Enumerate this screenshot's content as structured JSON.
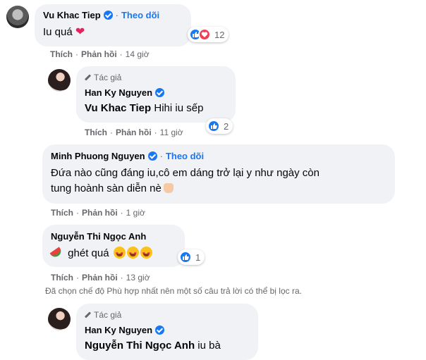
{
  "colors": {
    "accent": "#1877f2",
    "bubble": "#f0f2f5",
    "secondary_text": "#65676b",
    "love": "#f33e58"
  },
  "labels": {
    "like": "Thích",
    "reply": "Phản hồi",
    "follow": "Theo dõi",
    "author_tag": "Tác giả",
    "sep": "·"
  },
  "comments": [
    {
      "author": "Vu Khac Tiep",
      "verified": true,
      "follow": true,
      "text": "Iu quá",
      "emoji": "heart",
      "time": "14 giờ",
      "reaction_count": "12",
      "reactions": [
        "like",
        "love"
      ]
    },
    {
      "author": "Han Ky Nguyen",
      "verified": true,
      "author_tag": true,
      "mention": "Vu Khac Tiep",
      "text": "Hihi iu sếp",
      "time": "11 giờ",
      "reaction_count": "2",
      "reactions": [
        "like"
      ]
    },
    {
      "author": "Minh Phuong Nguyen",
      "verified": true,
      "follow": true,
      "text_line1": "Đứa nào cũng đáng iu,cô em dáng trở lại y như ngày còn",
      "text_line2": "tung hoành sàn diễn nè",
      "emoji": "thumbs-up",
      "time": "1 giờ"
    },
    {
      "author": "Nguyễn Thi Ngọc Anh",
      "verified": false,
      "text": "ghét quá",
      "emoji": "watermelon,heart-eyes x3",
      "time": "13 giờ",
      "reaction_count": "1",
      "reactions": [
        "like"
      ]
    },
    {
      "author": "Han Ky Nguyen",
      "verified": true,
      "author_tag": true,
      "mention": "Nguyễn Thi Ngọc Anh",
      "text": "iu bà"
    }
  ],
  "filter_note": "Đã chọn chế độ Phù hợp nhất nên một số câu trả lời có thể bị lọc ra."
}
